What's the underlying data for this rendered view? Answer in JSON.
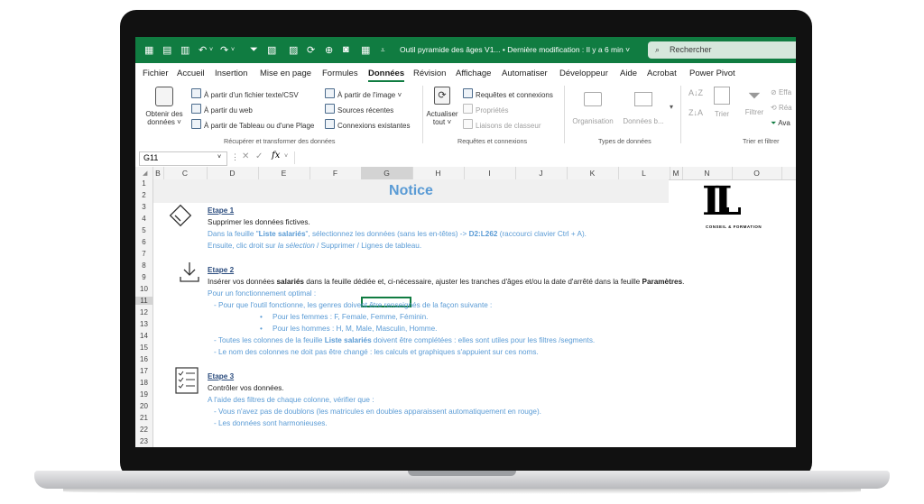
{
  "titlebar": {
    "doc_title": "Outil pyramide des âges V1...",
    "separator": "•",
    "last_modified": "Dernière modification : Il y a 6 min",
    "search_placeholder": "Rechercher"
  },
  "menu": {
    "tabs": [
      "Fichier",
      "Accueil",
      "Insertion",
      "Mise en page",
      "Formules",
      "Données",
      "Révision",
      "Affichage",
      "Automatiser",
      "Développeur",
      "Aide",
      "Acrobat",
      "Power Pivot"
    ]
  },
  "ribbon": {
    "get_data": "Obtenir des",
    "get_data2": "données ˅",
    "from_text": "À partir d'un fichier texte/CSV",
    "from_web": "À partir du web",
    "from_table": "À partir de Tableau ou d'une Plage",
    "from_image": "À partir de l'image ˅",
    "recent_sources": "Sources récentes",
    "existing_connections": "Connexions existantes",
    "group1": "Récupérer et transformer des données",
    "refresh1": "Actualiser",
    "refresh2": "tout ˅",
    "queries": "Requêtes et connexions",
    "properties": "Propriétés",
    "edit_links": "Liaisons de classeur",
    "group2": "Requêtes et connexions",
    "organisation": "Organisation",
    "donnees_b": "Données b...",
    "group3": "Types de données",
    "sort": "Trier",
    "filter": "Filtrer",
    "clear": "Effa",
    "reapply": "Réa",
    "advanced": "Ava",
    "group4": "Trier et filtrer"
  },
  "formula": {
    "cell_ref": "G11",
    "fx": "fx"
  },
  "columns": [
    "B",
    "C",
    "D",
    "E",
    "F",
    "G",
    "H",
    "I",
    "J",
    "K",
    "L",
    "M",
    "N",
    "O"
  ],
  "rows": [
    "1",
    "2",
    "3",
    "4",
    "5",
    "6",
    "7",
    "8",
    "9",
    "10",
    "11",
    "12",
    "13",
    "14",
    "15",
    "16",
    "17",
    "18",
    "19",
    "20",
    "21",
    "22",
    "23"
  ],
  "logo": {
    "letters": "LL",
    "tagline": "CONSEIL & FORMATION"
  },
  "notice": {
    "title": "Notice",
    "etape1": "Etape 1",
    "e1_l1": "Supprimer les données fictives.",
    "e1_l2a": "Dans la feuille \"",
    "e1_l2b": "Liste salariés",
    "e1_l2c": "\", sélectionnez les données (sans les en-têtes) -> ",
    "e1_l2d": "D2:L262",
    "e1_l2e": " (raccourci clavier Ctrl + A).",
    "e1_l3a": "Ensuite, clic droit sur ",
    "e1_l3b": "la sélection",
    "e1_l3c": " / Supprimer / Lignes de tableau.",
    "etape2": "Etape 2",
    "e2_l1a": "Insérer vos données ",
    "e2_l1b": "salariés",
    "e2_l1c": " dans la feuille dédiée et, ci-nécessaire, ajuster les tranches d'âges et/ou la date d'arrêté dans la feuille ",
    "e2_l1d": "Paramètres",
    "e2_l1e": ".",
    "e2_l2": "Pour un fonctionnement optimal :",
    "e2_l3": "-  Pour que l'outil fonctionne, les genres doivent être renseignés de la façon suivante :",
    "e2_l4": "Pour les femmes : F, Female, Femme, Féminin.",
    "e2_l5": "Pour les hommes : H, M, Male, Masculin, Homme.",
    "e2_l6a": "-  Toutes les colonnes de la feuille ",
    "e2_l6b": "Liste salariés",
    "e2_l6c": " doivent être complétées : elles sont utiles pour les filtres /segments.",
    "e2_l7": "-  Le nom des colonnes ne doit pas être changé : les calculs et graphiques s'appuient sur ces noms.",
    "etape3": "Etape 3",
    "e3_l1": "Contrôler vos données.",
    "e3_l2": "A l'aide des filtres de chaque colonne, vérifier que :",
    "e3_l3": "-  Vous n'avez pas de doublons (les matricules en doubles apparaissent automatiquement en rouge).",
    "e3_l4": "-  Les données sont harmonieuses."
  },
  "colors": {
    "excel_green": "#107c41",
    "notice_blue": "#5a9bd5"
  }
}
